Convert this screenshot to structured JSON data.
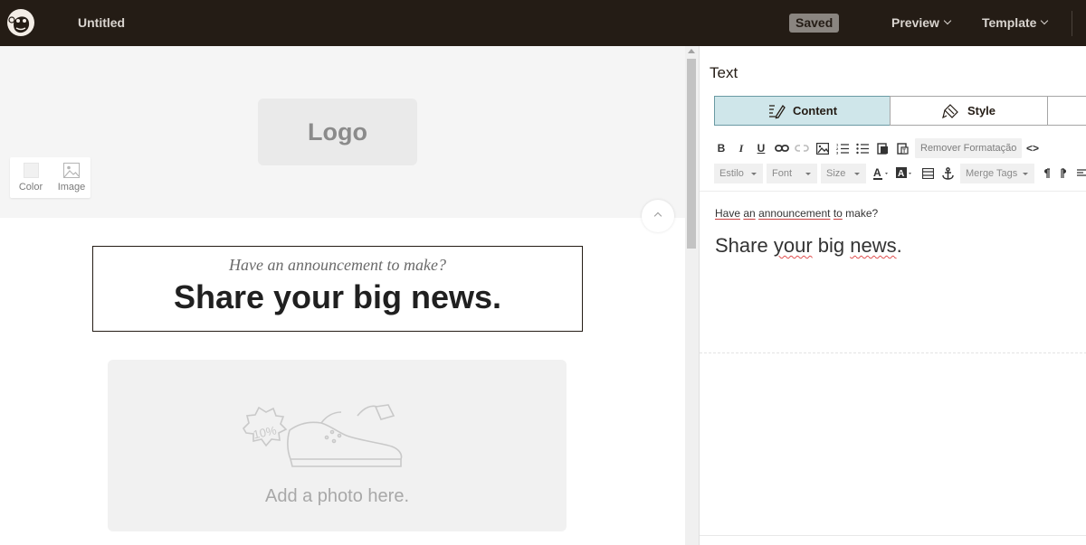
{
  "topbar": {
    "doc_title": "Untitled",
    "saved_label": "Saved",
    "menus": [
      "Preview",
      "Template"
    ]
  },
  "canvas": {
    "logo_placeholder": "Logo",
    "bg_tools": {
      "color_label": "Color",
      "image_label": "Image"
    },
    "text_block": {
      "announcement": "Have an announcement to make?",
      "headline": "Share your big news."
    },
    "photo_placeholder": {
      "label": "Add a photo here.",
      "badge": "10%"
    }
  },
  "panel": {
    "title": "Text",
    "tabs": {
      "content": "Content",
      "style": "Style"
    },
    "toolbar": {
      "bold": "B",
      "italic": "I",
      "underline": "U",
      "remove_format": "Remover Formatação",
      "source": "<>",
      "dropdowns": {
        "style": "Estilo",
        "font": "Font",
        "size": "Size",
        "merge_tags": "Merge Tags"
      }
    },
    "editor": {
      "small_words": [
        "Have",
        "an",
        "announcement",
        "to",
        "make?"
      ],
      "big_line": [
        "Share",
        "your",
        "big",
        "news",
        "."
      ]
    }
  },
  "colors": {
    "topbar_bg": "#241c15",
    "content_tab_bg": "#cfe6ea",
    "accent_border": "#6a9aa3"
  }
}
